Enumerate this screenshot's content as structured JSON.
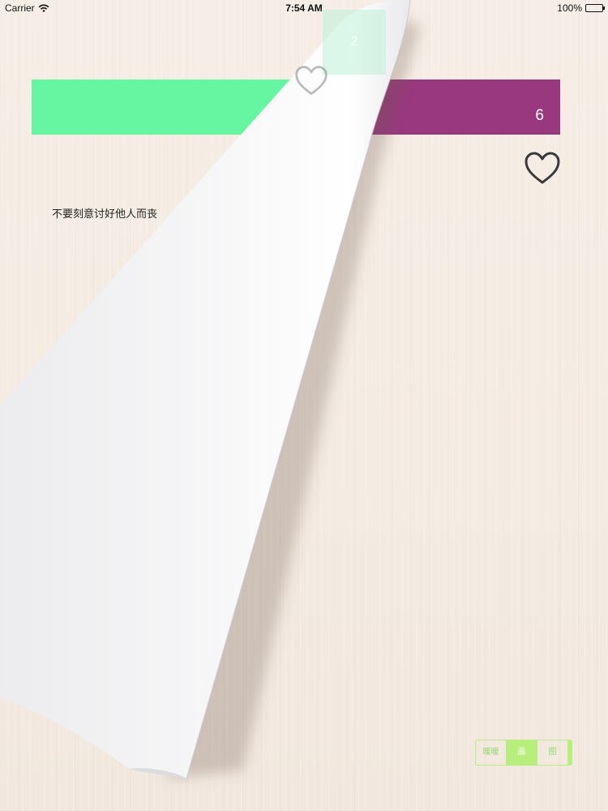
{
  "status_bar": {
    "carrier": "Carrier",
    "time": "7:54 AM",
    "battery": "100%"
  },
  "banner": {
    "number": "6",
    "back_tile_number": "2",
    "colors": {
      "left": "#66f5a1",
      "right": "#99387f"
    }
  },
  "content": {
    "quote": "不要刻意讨好他人而丧"
  },
  "segmented_control": {
    "segments": [
      "暖暖",
      "画",
      "图"
    ],
    "selected_index": 1,
    "accent": "#b8ee7b"
  },
  "icons": {
    "favorite": "heart-outline-icon",
    "wifi": "wifi-icon",
    "battery": "battery-icon"
  }
}
